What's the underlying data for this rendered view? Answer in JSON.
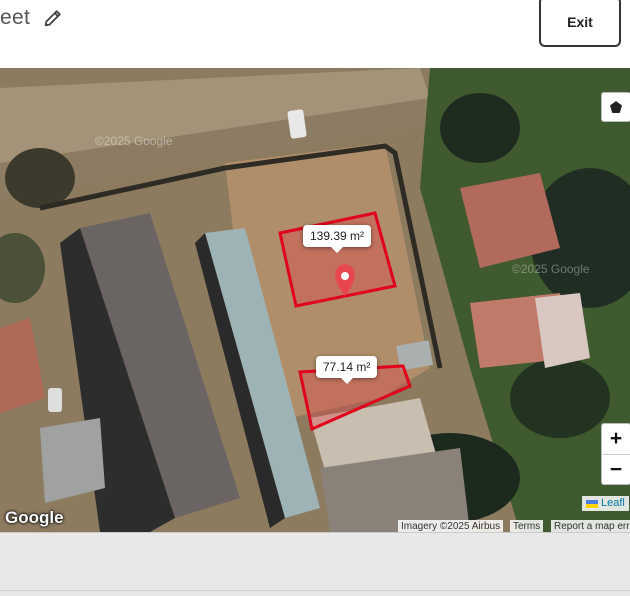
{
  "header": {
    "title": "eet",
    "exit_label": "Exit"
  },
  "map": {
    "polygons": [
      {
        "area_label": "139.39 m²"
      },
      {
        "area_label": "77.14 m²"
      }
    ],
    "watermarks": [
      "©2025 Google",
      "©2025 Google"
    ],
    "controls": {
      "draw_polygon_icon": "pentagon-icon",
      "zoom_in_label": "+",
      "zoom_out_label": "−"
    },
    "attribution": {
      "leaflet": "Leafl",
      "imagery": "Imagery ©2025 Airbus",
      "terms": "Terms",
      "report": "Report a map erro",
      "google": "Google"
    },
    "colors": {
      "polygon_stroke": "#e0001a",
      "polygon_fill": "rgba(230,60,70,0.35)",
      "marker": "#e8464f"
    }
  }
}
